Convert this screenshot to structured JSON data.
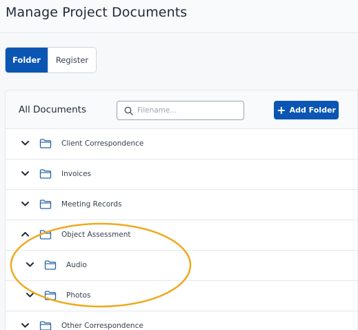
{
  "page": {
    "title": "Manage Project Documents"
  },
  "view_toggle": {
    "folder_label": "Folder",
    "register_label": "Register",
    "active": "Folder"
  },
  "documents_panel": {
    "title": "All Documents",
    "search": {
      "placeholder": "Filename...",
      "value": ""
    },
    "add_button_label": "Add Folder"
  },
  "folders": [
    {
      "label": "Client Correspondence",
      "level": 0,
      "expanded": false
    },
    {
      "label": "Invoices",
      "level": 0,
      "expanded": false
    },
    {
      "label": "Meeting Records",
      "level": 0,
      "expanded": false
    },
    {
      "label": "Object Assessment",
      "level": 0,
      "expanded": true
    },
    {
      "label": "Audio",
      "level": 1,
      "expanded": false
    },
    {
      "label": "Photos",
      "level": 1,
      "expanded": false
    },
    {
      "label": "Other Correspondence",
      "level": 0,
      "expanded": false
    }
  ],
  "icons": {
    "chevron": "chevron-down-icon",
    "chevron_expanded": "chevron-up-icon",
    "folder": "folder-icon",
    "search": "search-icon",
    "add": "plus-icon"
  },
  "colors": {
    "brand": "#0b56b3",
    "folder_icon": "#2563a8",
    "annotation_circle": "#f0a81c"
  }
}
